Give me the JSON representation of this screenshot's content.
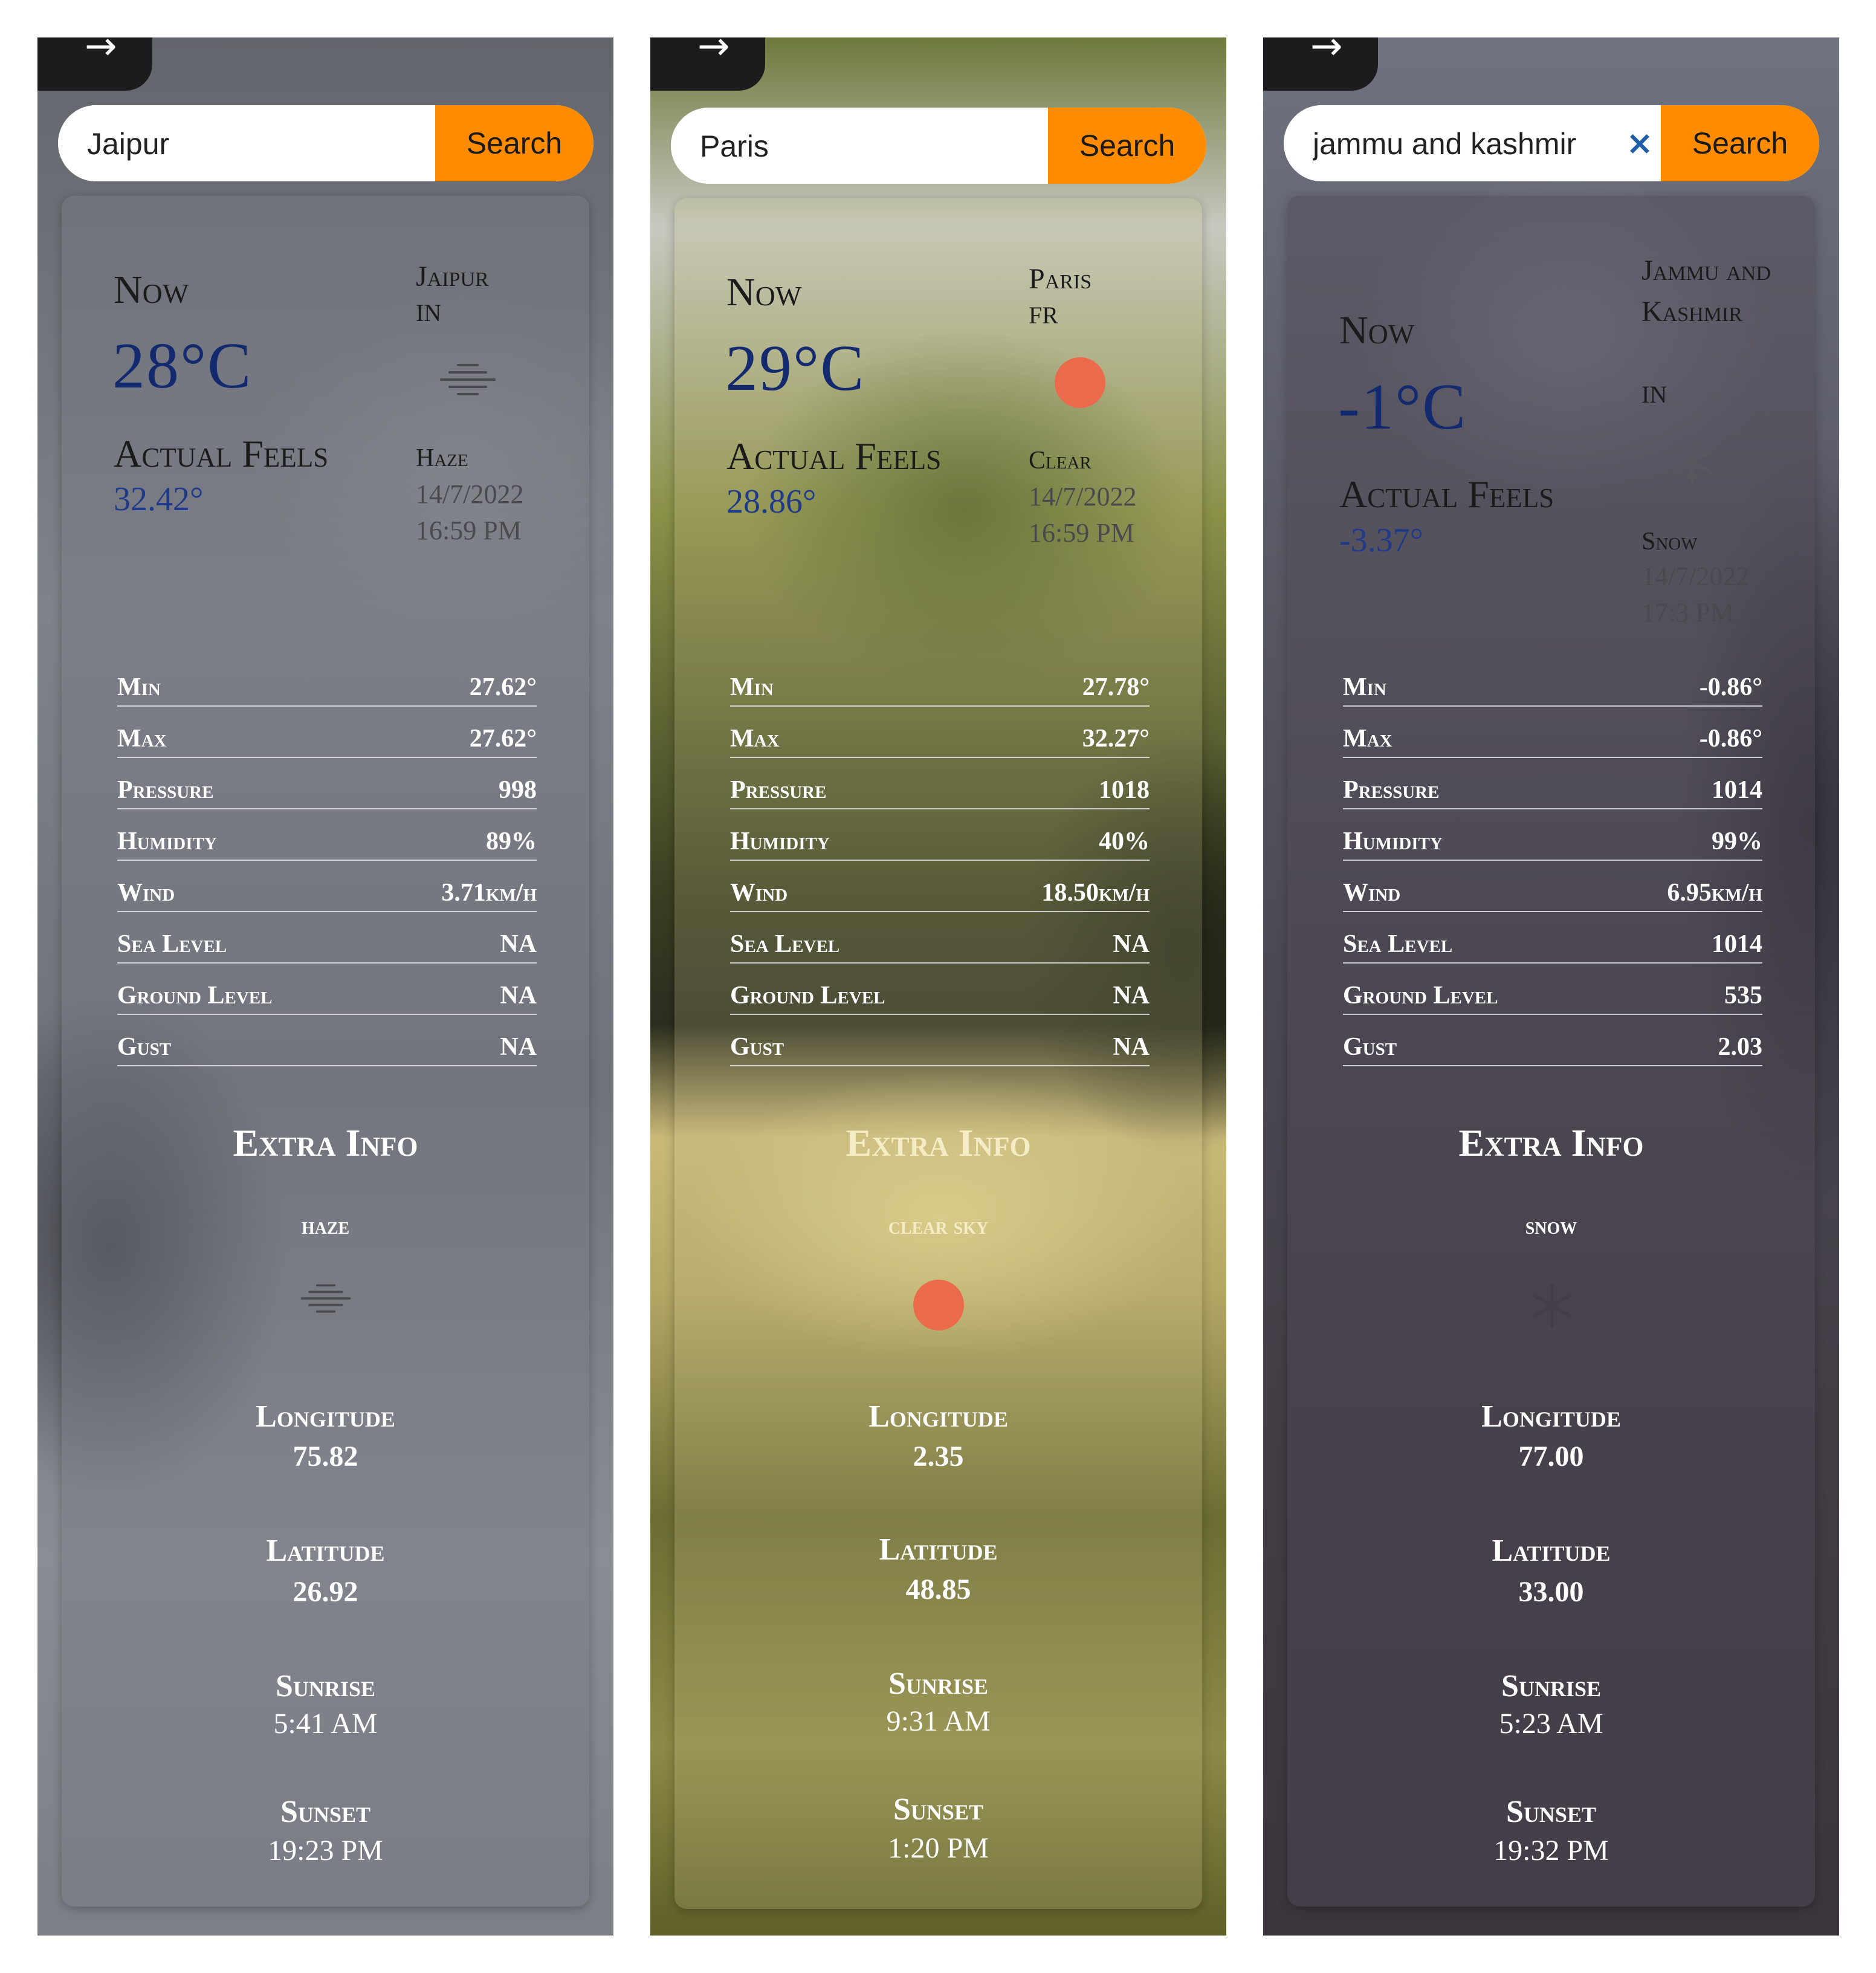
{
  "panels": [
    {
      "search_value": "Jaipur",
      "search_button": "Search",
      "now_label": "Now",
      "temp": "28°C",
      "feels_label": "Actual Feels",
      "feels_value": "32.42°",
      "city": "Jaipur",
      "country": "IN",
      "condition": "Haze",
      "date": "14/7/2022",
      "time": "16:59 PM",
      "icon": "haze-icon",
      "stats": [
        {
          "label": "Min",
          "value": "27.62°"
        },
        {
          "label": "Max",
          "value": "27.62°"
        },
        {
          "label": "Pressure",
          "value": "998"
        },
        {
          "label": "Humidity",
          "value": "89%"
        },
        {
          "label": "Wind",
          "value": "3.71km/h"
        },
        {
          "label": "Sea Level",
          "value": "NA"
        },
        {
          "label": "Ground Level",
          "value": "NA"
        },
        {
          "label": "Gust",
          "value": "NA"
        }
      ],
      "extra_title": "Extra Info",
      "extra_desc": "haze",
      "longitude_label": "Longitude",
      "longitude": "75.82",
      "latitude_label": "Latitude",
      "latitude": "26.92",
      "sunrise_label": "Sunrise",
      "sunrise": "5:41 AM",
      "sunset_label": "Sunset",
      "sunset": "19:23 PM"
    },
    {
      "search_value": "Paris",
      "search_button": "Search",
      "now_label": "Now",
      "temp": "29°C",
      "feels_label": "Actual Feels",
      "feels_value": "28.86°",
      "city": "Paris",
      "country": "FR",
      "condition": "Clear",
      "date": "14/7/2022",
      "time": "16:59 PM",
      "icon": "sun-icon",
      "stats": [
        {
          "label": "Min",
          "value": "27.78°"
        },
        {
          "label": "Max",
          "value": "32.27°"
        },
        {
          "label": "Pressure",
          "value": "1018"
        },
        {
          "label": "Humidity",
          "value": "40%"
        },
        {
          "label": "Wind",
          "value": "18.50km/h"
        },
        {
          "label": "Sea Level",
          "value": "NA"
        },
        {
          "label": "Ground Level",
          "value": "NA"
        },
        {
          "label": "Gust",
          "value": "NA"
        }
      ],
      "extra_title": "Extra Info",
      "extra_desc": "clear sky",
      "longitude_label": "Longitude",
      "longitude": "2.35",
      "latitude_label": "Latitude",
      "latitude": "48.85",
      "sunrise_label": "Sunrise",
      "sunrise": "9:31 AM",
      "sunset_label": "Sunset",
      "sunset": "1:20 PM"
    },
    {
      "search_value": "jammu and kashmir",
      "search_button": "Search",
      "clear_label": "×",
      "now_label": "Now",
      "temp": "-1°C",
      "feels_label": "Actual Feels",
      "feels_value": "-3.37°",
      "city": "Jammu and Kashmir",
      "country": "IN",
      "condition": "Snow",
      "date": "14/7/2022",
      "time": "17:3 PM",
      "icon": "snowflake-icon",
      "stats": [
        {
          "label": "Min",
          "value": "-0.86°"
        },
        {
          "label": "Max",
          "value": "-0.86°"
        },
        {
          "label": "Pressure",
          "value": "1014"
        },
        {
          "label": "Humidity",
          "value": "99%"
        },
        {
          "label": "Wind",
          "value": "6.95km/h"
        },
        {
          "label": "Sea Level",
          "value": "1014"
        },
        {
          "label": "Ground Level",
          "value": "535"
        },
        {
          "label": "Gust",
          "value": "2.03"
        }
      ],
      "extra_title": "Extra Info",
      "extra_desc": "snow",
      "longitude_label": "Longitude",
      "longitude": "77.00",
      "latitude_label": "Latitude",
      "latitude": "33.00",
      "sunrise_label": "Sunrise",
      "sunrise": "5:23 AM",
      "sunset_label": "Sunset",
      "sunset": "19:32 PM"
    }
  ],
  "colors": {
    "accent": "#ff8c00",
    "temp": "#142a6e",
    "sun": "#ec6a4c"
  }
}
